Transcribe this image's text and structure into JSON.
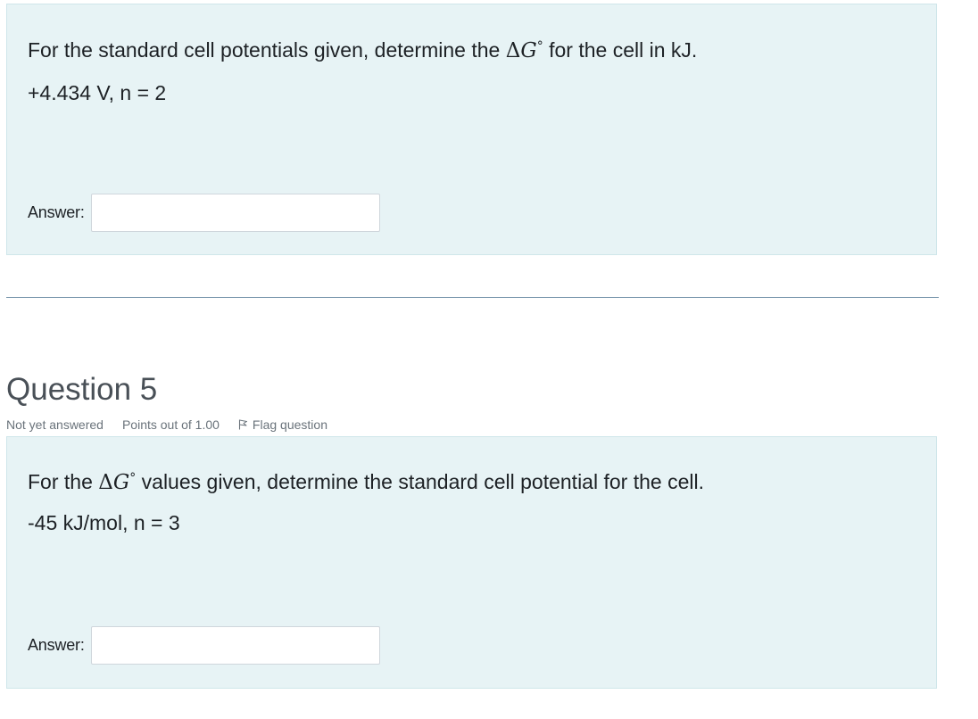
{
  "question4": {
    "prompt_before": "For the standard cell potentials given, determine the ",
    "delta_symbol": "Δ",
    "g_symbol": "G",
    "degree_symbol": "°",
    "prompt_after": " for the cell in kJ.",
    "given": "+4.434 V, n = 2",
    "answer_label": "Answer:",
    "answer_value": ""
  },
  "question5": {
    "title": "Question 5",
    "state": "Not yet answered",
    "grade": "Points out of 1.00",
    "flag_label": "Flag question",
    "prompt_before": "For the ",
    "delta_symbol": "Δ",
    "g_symbol": "G",
    "degree_symbol": "°",
    "prompt_after": " values given, determine the standard cell potential for the cell.",
    "given": "-45 kJ/mol, n = 3",
    "answer_label": "Answer:",
    "answer_value": ""
  },
  "icons": {
    "flag": "flag-icon"
  }
}
